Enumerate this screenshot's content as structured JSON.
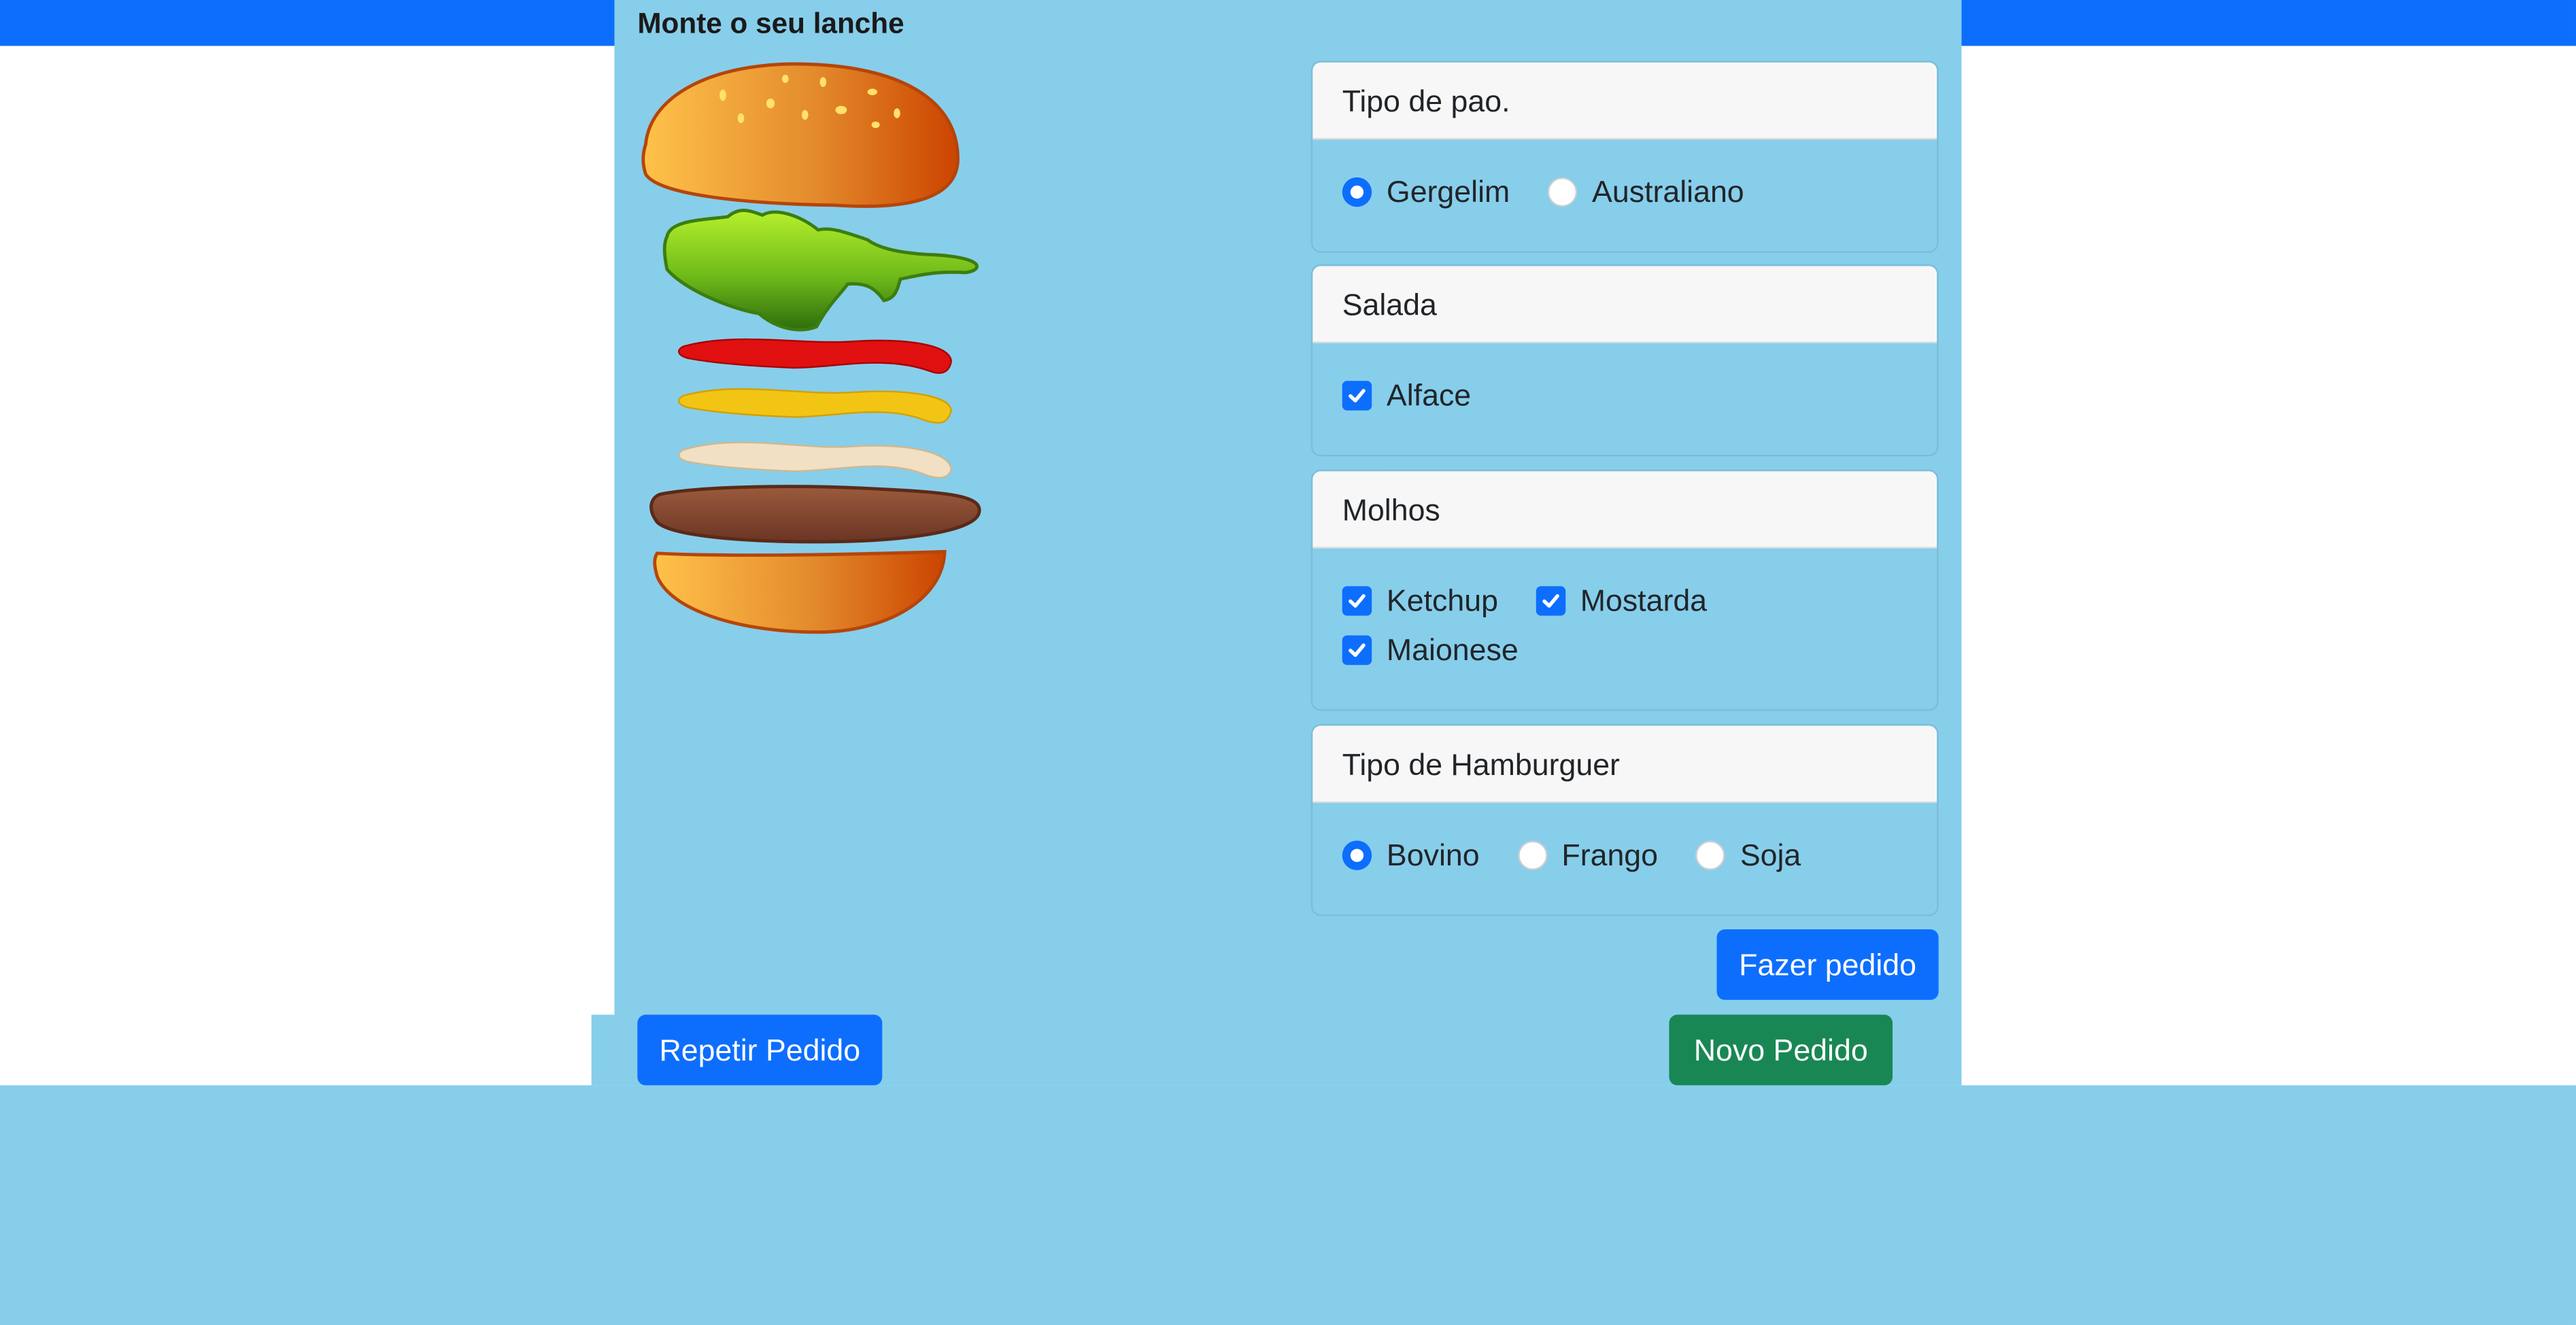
{
  "page": {
    "title": "Monte o seu lanche"
  },
  "colors": {
    "top_bar": "#0d6efd",
    "panel_background": "#87ceeb",
    "primary": "#0d6efd",
    "success": "#198754",
    "card_header": "#f7f7f7"
  },
  "burger_image": {
    "layers": [
      "top-bun-with-sesame",
      "lettuce",
      "ketchup",
      "mustard",
      "mayonnaise",
      "patty",
      "bottom-bun"
    ]
  },
  "cards": {
    "bread": {
      "title": "Tipo de pao.",
      "options": [
        {
          "label": "Gergelim",
          "selected": true
        },
        {
          "label": "Australiano",
          "selected": false
        }
      ]
    },
    "salad": {
      "title": "Salada",
      "options": [
        {
          "label": "Alface",
          "checked": true
        }
      ]
    },
    "sauces": {
      "title": "Molhos",
      "options": [
        {
          "label": "Ketchup",
          "checked": true
        },
        {
          "label": "Mostarda",
          "checked": true
        },
        {
          "label": "Maionese",
          "checked": true
        }
      ]
    },
    "burger_type": {
      "title": "Tipo de Hamburguer",
      "options": [
        {
          "label": "Bovino",
          "selected": true
        },
        {
          "label": "Frango",
          "selected": false
        },
        {
          "label": "Soja",
          "selected": false
        }
      ]
    }
  },
  "buttons": {
    "place_order": "Fazer pedido",
    "repeat_order": "Repetir Pedido",
    "new_order": "Novo Pedido"
  }
}
